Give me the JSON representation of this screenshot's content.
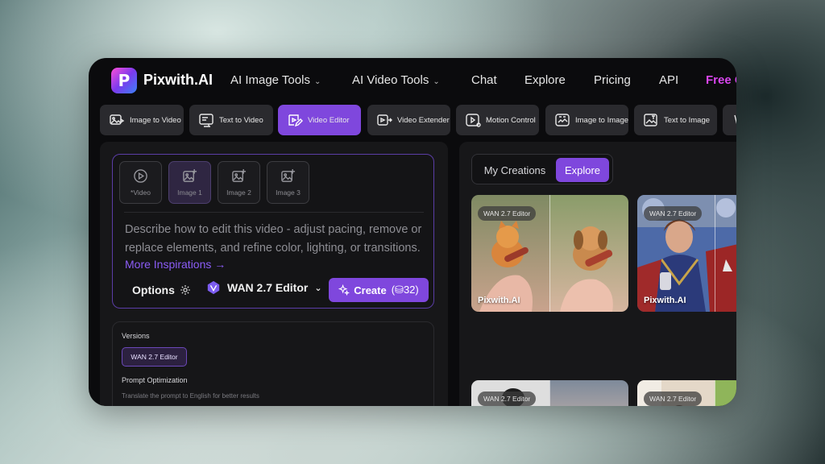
{
  "nav": {
    "brand": "Pixwith.AI",
    "logo_letter": "P",
    "items": [
      {
        "label": "AI Image Tools",
        "dropdown": true
      },
      {
        "label": "AI Video Tools",
        "dropdown": true
      },
      {
        "label": "Chat"
      },
      {
        "label": "Explore"
      },
      {
        "label": "Pricing"
      },
      {
        "label": "API"
      }
    ],
    "free_label": "Free C"
  },
  "tools": [
    {
      "label": "Image to Video",
      "icon": "image-play-icon"
    },
    {
      "label": "Text to Video",
      "icon": "text-video-icon"
    },
    {
      "label": "Video Editor",
      "icon": "video-edit-icon",
      "active": true
    },
    {
      "label": "Video Extender",
      "icon": "video-extend-icon"
    },
    {
      "label": "Motion Control",
      "icon": "motion-control-icon"
    },
    {
      "label": "Image to Image",
      "icon": "image-to-image-icon"
    },
    {
      "label": "Text to Image",
      "icon": "text-image-icon"
    }
  ],
  "prompt": {
    "inputs": [
      {
        "label": "*Video",
        "icon": "play-circle-icon"
      },
      {
        "label": "Image 1",
        "icon": "image-add-icon",
        "selected": true
      },
      {
        "label": "Image 2",
        "icon": "image-add-icon"
      },
      {
        "label": "Image 3",
        "icon": "image-add-icon"
      }
    ],
    "placeholder": "Describe how to edit this video - adjust pacing, remove or replace elements, and refine color, lighting, or transitions.",
    "inspirations_link": "More Inspirations →",
    "options_label": "Options",
    "model_label": "WAN 2.7 Editor",
    "create_label": "Create",
    "create_cost": "(⛁32)"
  },
  "settings": {
    "versions_title": "Versions",
    "version_chip": "WAN 2.7 Editor",
    "prompt_opt_title": "Prompt Optimization",
    "prompt_opt_sub": "Translate the prompt to English for better results"
  },
  "gallery": {
    "tabs": [
      "My Creations",
      "Explore"
    ],
    "active_tab": "Explore",
    "cards": [
      {
        "badge": "WAN 2.7 Editor",
        "watermark": "Pixwith.AI"
      },
      {
        "badge": "WAN 2.7 Editor",
        "watermark": "Pixwith.AI"
      },
      {
        "badge": "WAN 2.7 Editor"
      },
      {
        "badge": "WAN 2.7 Editor"
      }
    ]
  },
  "colors": {
    "accent": "#7f47dd",
    "free_text": "#d946ef",
    "link": "#8b5cf6"
  }
}
